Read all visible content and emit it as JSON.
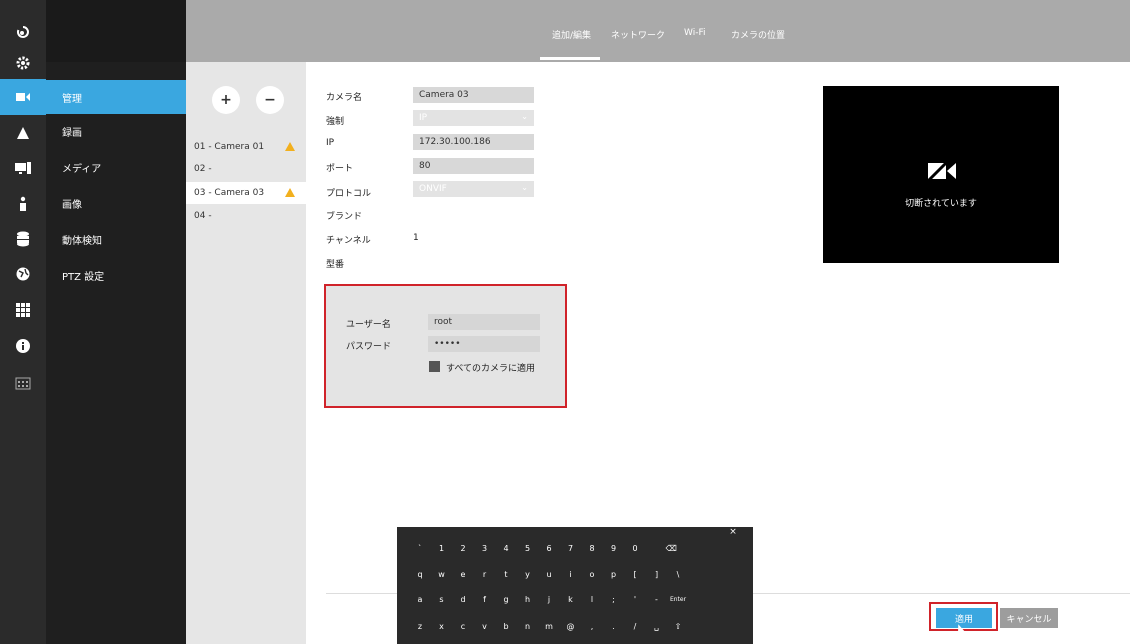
{
  "rail": {
    "icons": [
      "camera-back-icon",
      "gear-icon",
      "video-camera-icon",
      "bell-icon",
      "monitor-icon",
      "person-icon",
      "database-icon",
      "globe-icon",
      "grid-icon",
      "info-icon",
      "calendar-icon"
    ]
  },
  "nav": {
    "items": [
      {
        "label": "管理"
      },
      {
        "label": "録画"
      },
      {
        "label": "メディア"
      },
      {
        "label": "画像"
      },
      {
        "label": "動体検知"
      },
      {
        "label": "PTZ 設定"
      }
    ]
  },
  "tabs": [
    {
      "label": "追加/編集"
    },
    {
      "label": "ネットワーク"
    },
    {
      "label": "Wi-Fi"
    },
    {
      "label": "カメラの位置"
    }
  ],
  "camlist": {
    "add": "+",
    "remove": "−",
    "cameras": [
      {
        "label": "01 - Camera 01"
      },
      {
        "label": "02 -"
      },
      {
        "label": "03 - Camera 03"
      },
      {
        "label": "04 -"
      }
    ]
  },
  "form": {
    "labels": {
      "name": "カメラ名",
      "force": "強制",
      "ip": "IP",
      "port": "ポート",
      "protocol": "プロトコル",
      "brand": "ブランド",
      "channel": "チャンネル",
      "model": "型番"
    },
    "values": {
      "name": "Camera 03",
      "force": "IP",
      "ip": "172.30.100.186",
      "port": "80",
      "protocol": "ONVIF",
      "channel": "1"
    }
  },
  "credentials": {
    "user_label": "ユーザー名",
    "user_value": "root",
    "pass_label": "パスワード",
    "pass_value": "•••••",
    "apply_all": "すべてのカメラに適用"
  },
  "preview": {
    "status": "切断されています"
  },
  "keyboard": {
    "close": "×",
    "rows": [
      [
        "`",
        "1",
        "2",
        "3",
        "4",
        "5",
        "6",
        "7",
        "8",
        "9",
        "0",
        "⌫"
      ],
      [
        "q",
        "w",
        "e",
        "r",
        "t",
        "y",
        "u",
        "i",
        "o",
        "p",
        "[",
        "]",
        "\\"
      ],
      [
        "a",
        "s",
        "d",
        "f",
        "g",
        "h",
        "j",
        "k",
        "l",
        ";",
        "'",
        "-",
        "Enter"
      ],
      [
        "z",
        "x",
        "c",
        "v",
        "b",
        "n",
        "m",
        "@",
        ",",
        ".",
        "/",
        "␣",
        "⇧"
      ]
    ]
  },
  "actions": {
    "apply": "適用",
    "cancel": "キャンセル"
  },
  "colors": {
    "accent": "#3aa7e0",
    "highlight": "#d0232a",
    "warning": "#f2b01e"
  }
}
